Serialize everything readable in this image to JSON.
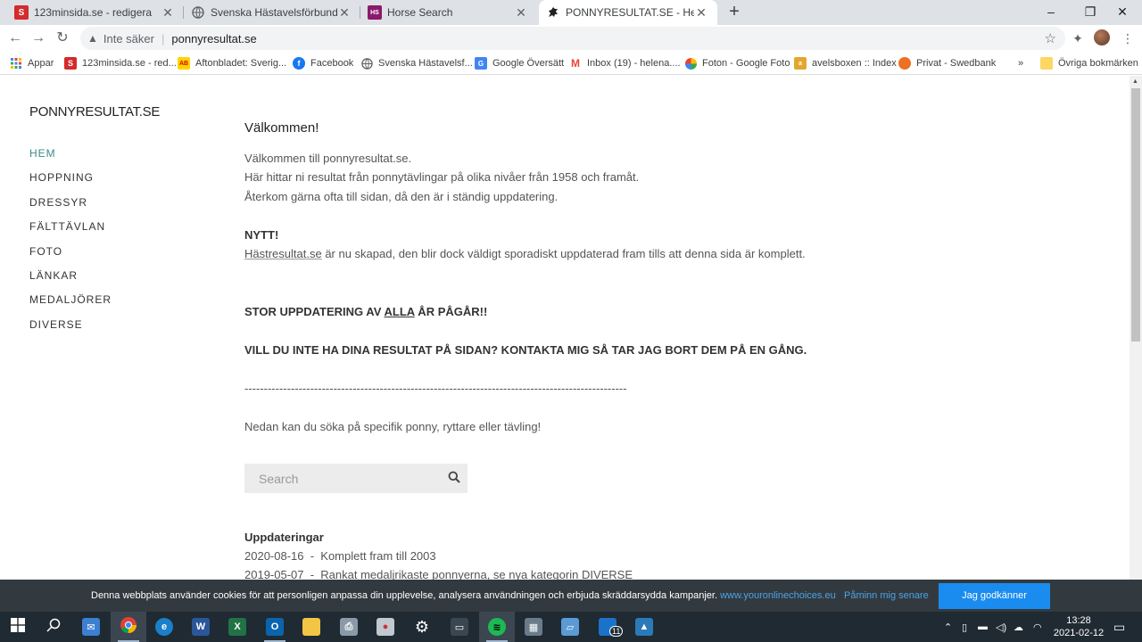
{
  "browser": {
    "tabs": [
      {
        "title": "123minsida.se - redigera",
        "favicon": "s-logo-icon",
        "color": "#d42b2b",
        "active": false
      },
      {
        "title": "Svenska Hästavelsförbundets web",
        "favicon": "globe-icon",
        "color": "#5f6368",
        "active": false
      },
      {
        "title": "Horse Search",
        "favicon": "horse-search-icon",
        "color": "#8b1a6b",
        "active": false
      },
      {
        "title": "PONNYRESULTAT.SE - Hem",
        "favicon": "horse-icon",
        "color": "#222222",
        "active": true
      }
    ],
    "address": {
      "security_label": "Inte säker",
      "url": "ponnyresultat.se"
    },
    "bookmarks": [
      {
        "label": "Appar",
        "icon": "apps-grid-icon"
      },
      {
        "label": "123minsida.se - red...",
        "icon": "s-logo-icon"
      },
      {
        "label": "Aftonbladet: Sverig...",
        "icon": "ab-logo-icon"
      },
      {
        "label": "Facebook",
        "icon": "facebook-icon"
      },
      {
        "label": "Svenska Hästavelsf...",
        "icon": "globe-icon"
      },
      {
        "label": "Google Översätt",
        "icon": "translate-icon"
      },
      {
        "label": "Inbox (19) - helena....",
        "icon": "gmail-icon"
      },
      {
        "label": "Foton - Google Foto",
        "icon": "photos-icon"
      },
      {
        "label": "avelsboxen :: Index",
        "icon": "avelsboxen-icon"
      },
      {
        "label": "Privat - Swedbank",
        "icon": "swedbank-icon"
      }
    ],
    "bookmarks_more": "»",
    "other_bookmarks": "Övriga bokmärken"
  },
  "site": {
    "logo": "PONNYRESULTAT.SE",
    "nav": [
      {
        "label": "HEM",
        "active": true
      },
      {
        "label": "HOPPNING",
        "active": false
      },
      {
        "label": "DRESSYR",
        "active": false
      },
      {
        "label": "FÄLTTÄVLAN",
        "active": false
      },
      {
        "label": "FOTO",
        "active": false
      },
      {
        "label": "LÄNKAR",
        "active": false
      },
      {
        "label": "MEDALJÖRER",
        "active": false
      },
      {
        "label": "DIVERSE",
        "active": false
      }
    ],
    "accent_color": "#3a8a8c"
  },
  "main": {
    "heading": "Välkommen!",
    "intro": [
      "Välkommen till ponnyresultat.se.",
      "Här hittar ni resultat från ponnytävlingar på olika nivåer från 1958 och framåt.",
      "Återkom gärna ofta till sidan, då den är i ständig uppdatering."
    ],
    "news_heading": "NYTT!",
    "news_link": "Hästresultat.se",
    "news_text": " är nu skapad, den blir dock väldigt sporadiskt uppdaterad fram tills att denna sida är komplett.",
    "big_update_pre": "STOR UPPDATERING AV ",
    "big_update_link": "ALLA",
    "big_update_post": " ÅR PÅGÅR!!",
    "contact_notice": "VILL DU INTE HA DINA RESULTAT PÅ SIDAN? KONTAKTA MIG SÅ TAR JAG BORT DEM PÅ EN GÅNG.",
    "divider": "---------------------------------------------------------------------------------------------------",
    "search_prompt": "Nedan kan du söka på specifik ponny, ryttare eller tävling!",
    "search_placeholder": "Search",
    "updates_heading": "Uppdateringar",
    "updates": [
      "2020-08-16  -  Komplett fram till 2003",
      "2019-05-07  -  Rankat medaljrikaste ponnyerna, se nya kategorin DIVERSE"
    ]
  },
  "cookie": {
    "message": "Denna webbplats använder cookies för att personligen anpassa din upplevelse, analysera användningen och erbjuda skräddarsydda kampanjer.",
    "link": "www.youronlinechoices.eu",
    "remind": "Påminn mig senare",
    "accept": "Jag godkänner"
  },
  "taskbar": {
    "clock_time": "13:28",
    "clock_date": "2021-02-12",
    "mail_badge": "11"
  }
}
